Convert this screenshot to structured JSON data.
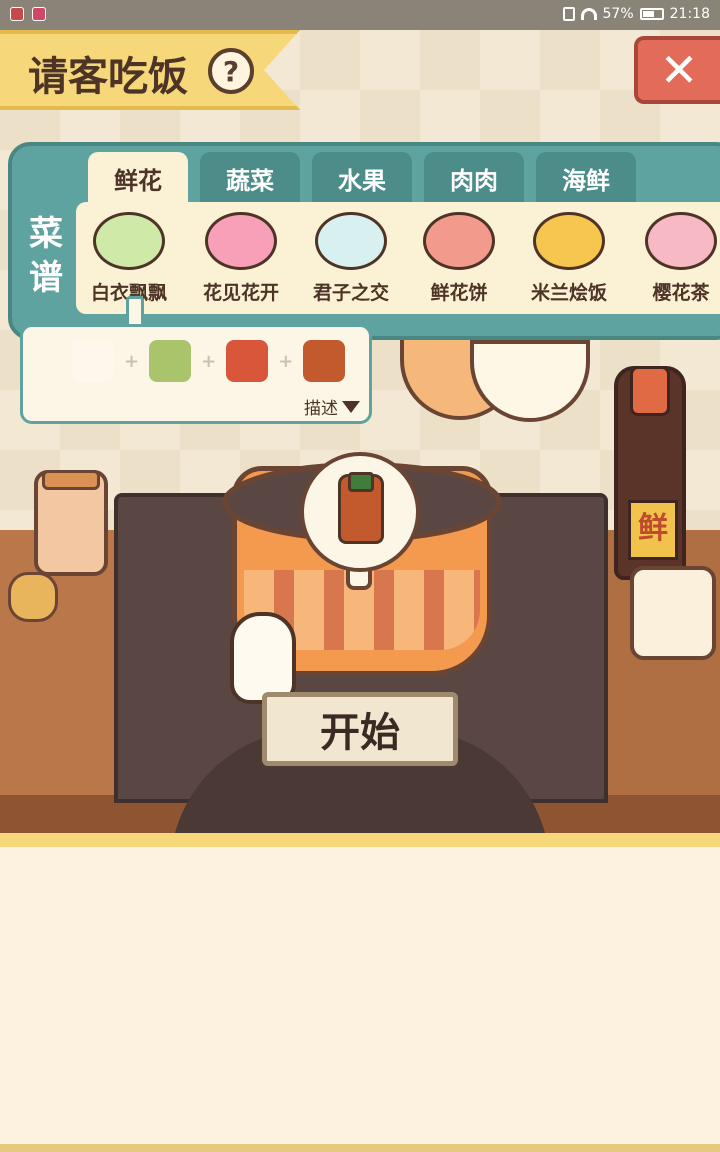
{
  "status_bar": {
    "battery": "57%",
    "time": "21:18"
  },
  "title": {
    "text": "请客吃饭",
    "help": "?"
  },
  "close": {
    "label": "✕"
  },
  "recipe": {
    "label": "菜谱",
    "tabs": [
      {
        "label": "鲜花",
        "active": true
      },
      {
        "label": "蔬菜",
        "active": false
      },
      {
        "label": "水果",
        "active": false
      },
      {
        "label": "肉肉",
        "active": false
      },
      {
        "label": "海鲜",
        "active": false
      }
    ],
    "dishes": [
      {
        "name": "白衣飘飘",
        "color": "#cfe9a8"
      },
      {
        "name": "花见花开",
        "color": "#f7a0b8"
      },
      {
        "name": "君子之交",
        "color": "#d9f0f0"
      },
      {
        "name": "鲜花饼",
        "color": "#f29a8c"
      },
      {
        "name": "米兰烩饭",
        "color": "#f7c64e"
      },
      {
        "name": "樱花茶",
        "color": "#f7b9c4"
      }
    ]
  },
  "ingredient_popup": {
    "plus": "+",
    "describe": "描述",
    "ingredients": [
      {
        "icon": "lily-flower-icon",
        "color": "#fff7ec"
      },
      {
        "icon": "asparagus-icon",
        "color": "#a9c46a"
      },
      {
        "icon": "goji-berries-icon",
        "color": "#d9563a"
      },
      {
        "icon": "sauce-bottle-icon",
        "color": "#c35a2e"
      }
    ]
  },
  "scene": {
    "sauce_label": "鲜"
  },
  "start_button": {
    "label": "开始"
  },
  "colors": {
    "accent_teal": "#5ea3a0",
    "banner_yellow": "#f6d77a",
    "close_red": "#e26b5a",
    "text_brown": "#4d3427"
  }
}
